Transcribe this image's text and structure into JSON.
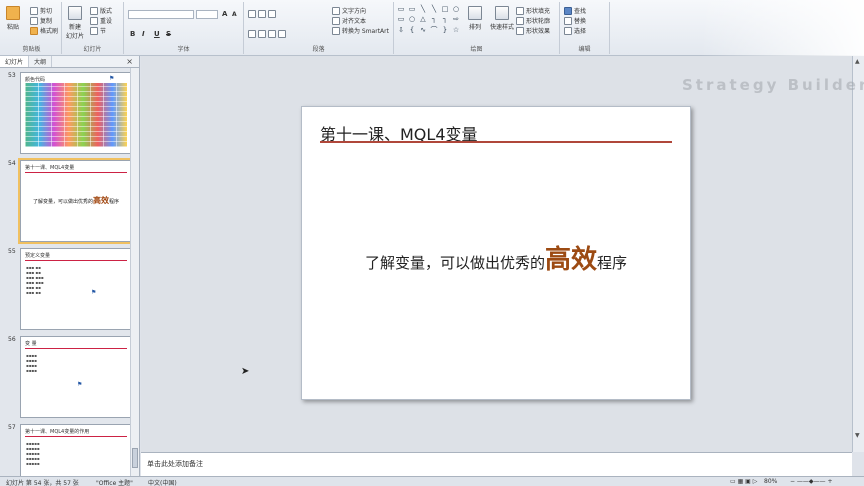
{
  "ribbon": {
    "clipboard": {
      "paste": "粘贴",
      "cut": "剪切",
      "copy": "复制",
      "format_painter": "格式刷",
      "label": "剪贴板"
    },
    "slides": {
      "new_slide": "新建\n幻灯片",
      "layout": "版式",
      "reset": "重设",
      "section": "节",
      "label": "幻灯片"
    },
    "font": {
      "label": "字体",
      "bold": "B",
      "italic": "I",
      "underline": "U",
      "strike": "S",
      "grow": "A",
      "shrink": "A"
    },
    "paragraph": {
      "label": "段落",
      "text_direction": "文字方向",
      "align_text": "对齐文本",
      "smartart": "转换为 SmartArt"
    },
    "drawing": {
      "label": "绘图",
      "arrange": "排列",
      "quick_styles": "快速样式",
      "shape_fill": "形状填充",
      "shape_outline": "形状轮廓",
      "shape_effects": "形状效果"
    },
    "editing": {
      "label": "编辑",
      "find": "查找",
      "replace": "替换",
      "select": "选择"
    }
  },
  "left_panel": {
    "tabs": [
      "幻灯片",
      "大纲"
    ],
    "close": "×",
    "slides": [
      {
        "number": "53",
        "title": "颜色代码"
      },
      {
        "number": "54",
        "title": "第十一课、MQL4变量",
        "body_prefix": "了解变量，可以做出优秀的",
        "body_emph": "高效",
        "body_suffix": "程序"
      },
      {
        "number": "55",
        "title": "预定义变量"
      },
      {
        "number": "56",
        "title": "变 量"
      },
      {
        "number": "57",
        "title": "第十一课、MQL4变量的作用"
      }
    ]
  },
  "slide": {
    "title": "第十一课、MQL4变量",
    "body_prefix": "了解变量，可以做出优秀的",
    "body_emph": "高效",
    "body_suffix": "程序"
  },
  "notes": {
    "placeholder": "单击此处添加备注"
  },
  "status": {
    "slide_count": "幻灯片 第 54 张，共 57 张",
    "theme": "\"Office 主题\"",
    "language": "中文(中国)",
    "zoom": "80%"
  },
  "watermark": "Strategy Builder",
  "colors": {
    "accent_rule": "#b0473a",
    "emphasis": "#9c4a12"
  }
}
